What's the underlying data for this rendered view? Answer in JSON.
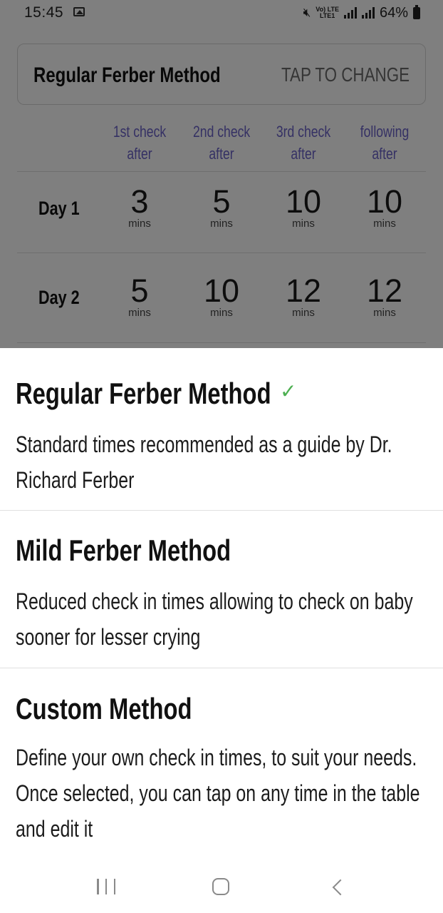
{
  "status_bar": {
    "time": "15:45",
    "network_top": "Vo) LTE",
    "network_bottom": "LTE1",
    "battery": "64%"
  },
  "screen": {
    "method_title": "Regular Ferber Method",
    "change_label": "TAP TO CHANGE",
    "table": {
      "headers": [
        {
          "line1": "1st check",
          "line2": "after"
        },
        {
          "line1": "2nd check",
          "line2": "after"
        },
        {
          "line1": "3rd check",
          "line2": "after"
        },
        {
          "line1": "following",
          "line2": "after"
        }
      ],
      "rows": [
        {
          "day": "Day 1",
          "values": [
            "3",
            "5",
            "10",
            "10"
          ],
          "unit": "mins"
        },
        {
          "day": "Day 2",
          "values": [
            "5",
            "10",
            "12",
            "12"
          ],
          "unit": "mins"
        }
      ]
    }
  },
  "sheet": {
    "options": [
      {
        "title": "Regular Ferber Method",
        "desc": "Standard times recommended as a guide by Dr. Richard Ferber",
        "selected": true
      },
      {
        "title": "Mild Ferber Method",
        "desc": "Reduced check in times allowing to check on baby sooner for lesser crying",
        "selected": false
      },
      {
        "title": "Custom Method",
        "desc": "Define your own check in times, to suit your needs. Once selected, you can tap on any time in the table and edit it",
        "selected": false
      }
    ]
  },
  "colors": {
    "accent_header": "#6b62c9",
    "check": "#4caf50",
    "scrim": "rgba(0,0,0,0.5)"
  },
  "icons": {
    "selected": "check-icon",
    "nav": [
      "recents-icon",
      "home-icon",
      "back-icon"
    ]
  }
}
